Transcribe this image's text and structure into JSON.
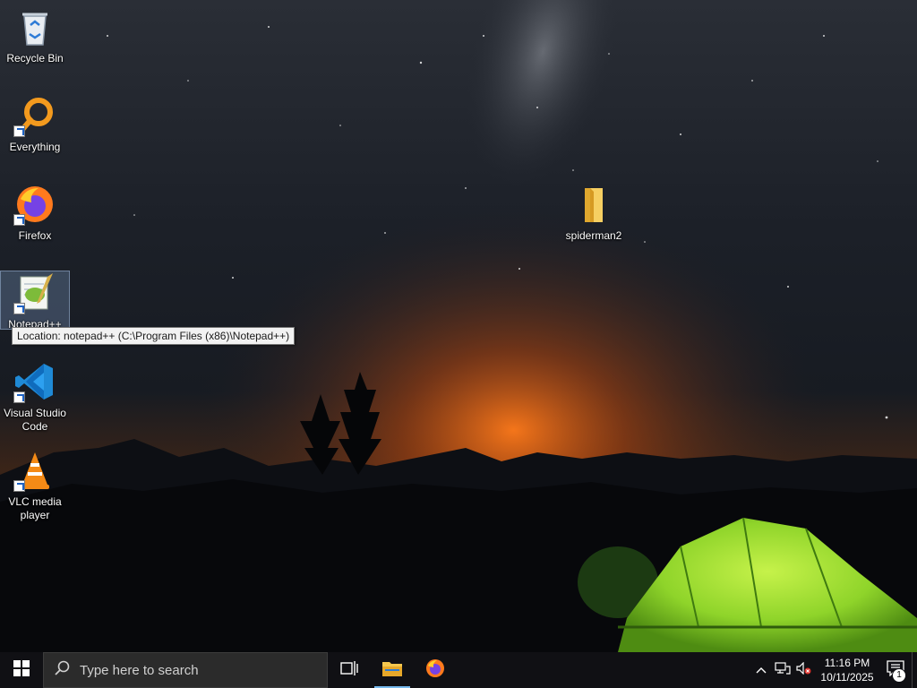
{
  "desktop": {
    "icons": [
      {
        "label": "Recycle Bin",
        "icon": "recycle-bin-icon"
      },
      {
        "label": "Everything",
        "icon": "everything-search-icon"
      },
      {
        "label": "Firefox",
        "icon": "firefox-icon"
      },
      {
        "label": "Notepad++",
        "icon": "notepad-plus-plus-icon"
      },
      {
        "label": "Visual Studio Code",
        "icon": "vscode-icon"
      },
      {
        "label": "VLC media player",
        "icon": "vlc-icon"
      },
      {
        "label": "spiderman2",
        "icon": "folder-icon"
      }
    ],
    "tooltip": "Location: notepad++ (C:\\Program Files (x86)\\Notepad++)"
  },
  "taskbar": {
    "search_placeholder": "Type here to search",
    "pinned": [
      {
        "name": "Task View",
        "icon": "task-view-icon"
      },
      {
        "name": "File Explorer",
        "icon": "file-explorer-icon"
      },
      {
        "name": "Firefox",
        "icon": "firefox-icon"
      }
    ],
    "clock": {
      "time": "11:16 PM",
      "date": "10/11/2025"
    },
    "notification_count": "1"
  },
  "colors": {
    "taskbar_bg": "#101014",
    "accent": "#76b9ed",
    "tent_green": "#8fd42a"
  }
}
